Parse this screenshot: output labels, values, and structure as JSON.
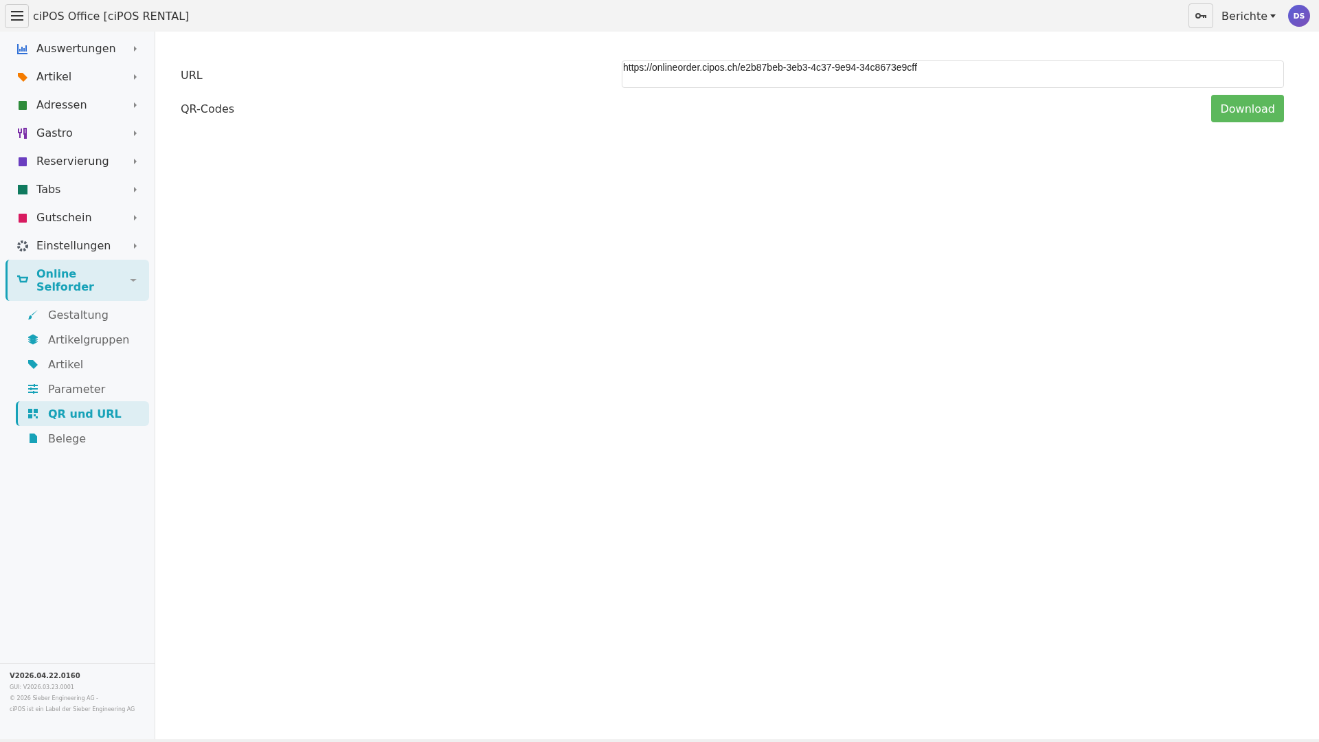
{
  "header": {
    "title": "ciPOS Office [ciPOS RENTAL]",
    "reports_menu": "Berichte",
    "avatar": "DS"
  },
  "sidebar": {
    "items": [
      {
        "label": "Auswertungen",
        "expanded": false
      },
      {
        "label": "Artikel",
        "expanded": false
      },
      {
        "label": "Adressen",
        "expanded": false
      },
      {
        "label": "Gastro",
        "expanded": false
      },
      {
        "label": "Reservierung",
        "expanded": false
      },
      {
        "label": "Tabs",
        "expanded": false
      },
      {
        "label": "Gutschein",
        "expanded": false
      },
      {
        "label": "Einstellungen",
        "expanded": false
      },
      {
        "label": "Online Selforder",
        "expanded": true,
        "children": [
          {
            "label": "Gestaltung",
            "selected": false
          },
          {
            "label": "Artikelgruppen",
            "selected": false
          },
          {
            "label": "Artikel",
            "selected": false
          },
          {
            "label": "Parameter",
            "selected": false
          },
          {
            "label": "QR und URL",
            "selected": true
          },
          {
            "label": "Belege",
            "selected": false
          }
        ]
      }
    ],
    "footer": {
      "version": "V2026.04.22.0160",
      "gui_version": "GUI: V2026.03.23.0001",
      "copyright": "© 2026 Sieber Engineering AG -",
      "label_note": "ciPOS ist ein Label der Sieber Engineering AG"
    }
  },
  "form": {
    "url_label": "URL",
    "url_value": "https://onlineorder.cipos.ch/e2b87beb-3eb3-4c37-9e94-34c8673e9cff",
    "qr_label": "QR-Codes",
    "download_button": "Download"
  }
}
